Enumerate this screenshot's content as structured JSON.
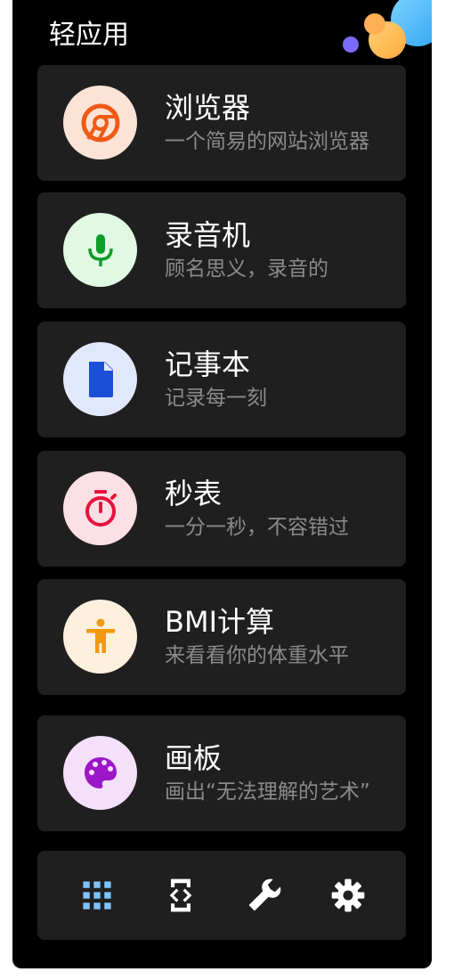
{
  "header": {
    "title": "轻应用"
  },
  "apps": [
    {
      "title": "浏览器",
      "subtitle": "一个简易的网站浏览器",
      "icon": "chrome-icon",
      "icon_bg": "#fde3d6",
      "icon_color": "#ef5a16"
    },
    {
      "title": "录音机",
      "subtitle": "顾名思义，录音的",
      "icon": "microphone-icon",
      "icon_bg": "#e1f8e3",
      "icon_color": "#0f9d2a"
    },
    {
      "title": "记事本",
      "subtitle": "记录每一刻",
      "icon": "document-icon",
      "icon_bg": "#e2e8fb",
      "icon_color": "#1b4fd6"
    },
    {
      "title": "秒表",
      "subtitle": "一分一秒，不容错过",
      "icon": "stopwatch-icon",
      "icon_bg": "#fde0e6",
      "icon_color": "#e8113d"
    },
    {
      "title": "BMI计算",
      "subtitle": "来看看你的体重水平",
      "icon": "accessibility-icon",
      "icon_bg": "#fdf0dc",
      "icon_color": "#f29a0e"
    },
    {
      "title": "画板",
      "subtitle": "画出“无法理解的艺术”",
      "icon": "palette-icon",
      "icon_bg": "#f5e0fb",
      "icon_color": "#9b17c9"
    }
  ],
  "bottom_bar": {
    "items": [
      {
        "icon": "apps-grid-icon",
        "color": "#7ec4ff"
      },
      {
        "icon": "developer-mode-icon",
        "color": "#ffffff"
      },
      {
        "icon": "wrench-icon",
        "color": "#ffffff"
      },
      {
        "icon": "settings-gear-icon",
        "color": "#ffffff"
      }
    ]
  }
}
